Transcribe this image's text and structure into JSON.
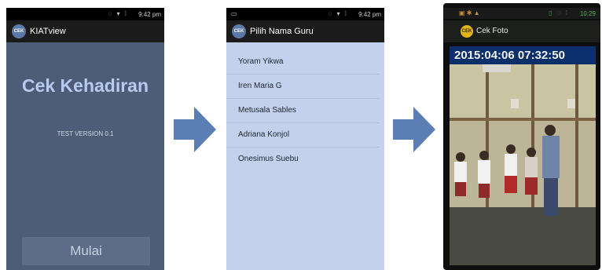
{
  "phone1": {
    "status_time": "9:42",
    "status_ampm": "pm",
    "app_title": "KIATview",
    "logo_text": "CEK",
    "screen_title": "Cek Kehadiran",
    "version": "TEST VERSION 0.1",
    "start_button": "Mulai"
  },
  "phone2": {
    "status_time": "9:42",
    "status_ampm": "pm",
    "app_title": "Pilih Nama Guru",
    "logo_text": "CEK",
    "names": [
      "Yoram Yikwa",
      "Iren Maria G",
      "Metusala Sables",
      "Adriana Konjol",
      "Onesimus Suebu"
    ]
  },
  "phone3": {
    "status_time": "10:29",
    "app_title": "Cek Foto",
    "logo_text": "CEK",
    "timestamp": "2015:04:06 07:32:50"
  },
  "icons": {
    "arrow": "right-arrow-icon",
    "camera_photo": "classroom-photo"
  },
  "colors": {
    "arrow": "#5b7fb4",
    "phone1_bg": "#4e5d77",
    "phone2_bg": "#c4d1ec",
    "timestamp_bg": "#0a2f6a"
  }
}
